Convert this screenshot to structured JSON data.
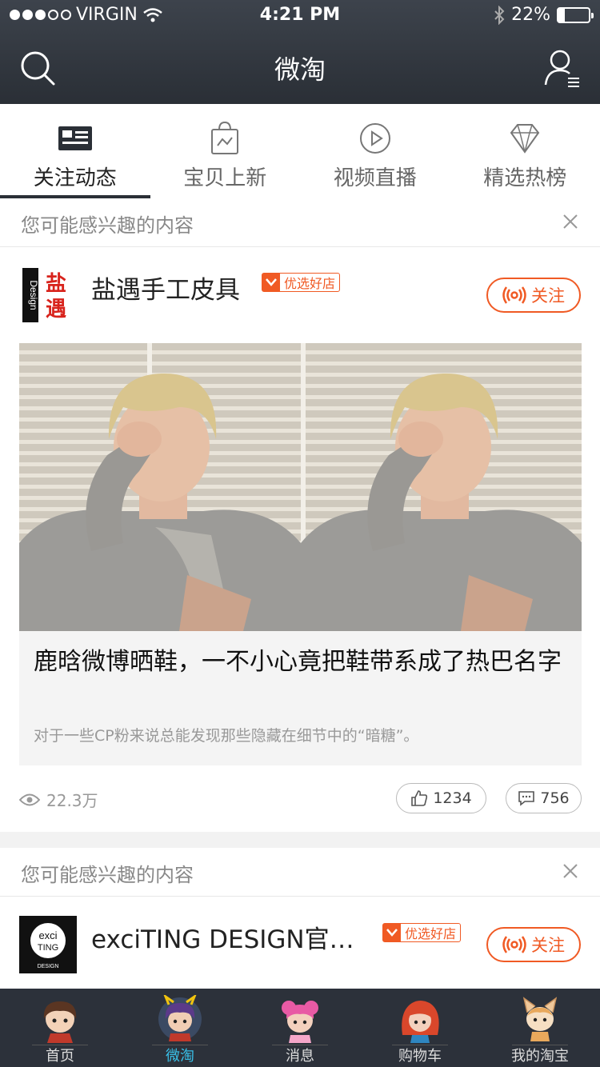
{
  "status_bar": {
    "carrier": "VIRGIN",
    "time": "4:21 PM",
    "battery": "22%",
    "battery_level": 0.22
  },
  "header": {
    "title": "微淘"
  },
  "tabs": [
    {
      "label": "关注动态",
      "icon": "news-card-icon",
      "active": true
    },
    {
      "label": "宝贝上新",
      "icon": "shopping-bag-icon",
      "active": false
    },
    {
      "label": "视频直播",
      "icon": "play-circle-icon",
      "active": false
    },
    {
      "label": "精选热榜",
      "icon": "diamond-icon",
      "active": false
    }
  ],
  "feed": [
    {
      "section_title": "您可能感兴趣的内容",
      "shop_name": "盐遇手工皮具",
      "badge": "优选好店",
      "follow_label": "关注",
      "post_title": "鹿晗微博晒鞋，一不小心竟把鞋带系成了热巴名字",
      "post_desc": "对于一些CP粉来说总能发现那些隐藏在细节中的“暗糖”。",
      "views": "22.3万",
      "likes": "1234",
      "comments": "756"
    },
    {
      "section_title": "您可能感兴趣的内容",
      "shop_name": "exciTING DESIGN官…",
      "badge": "优选好店",
      "follow_label": "关注"
    }
  ],
  "logos": {
    "shop1": {
      "big": "盐遇",
      "vertical": "Design"
    },
    "shop2": {
      "line1": "exci",
      "line2": "TING",
      "line3": "DESIGN"
    }
  },
  "tabbar": [
    {
      "label": "首页",
      "active": false
    },
    {
      "label": "微淘",
      "active": true
    },
    {
      "label": "消息",
      "active": false
    },
    {
      "label": "购物车",
      "active": false
    },
    {
      "label": "我的淘宝",
      "active": false
    }
  ],
  "colors": {
    "accent": "#f05a24",
    "header_bg": "#2a2f36",
    "tabbar_active": "#39c0e8"
  }
}
